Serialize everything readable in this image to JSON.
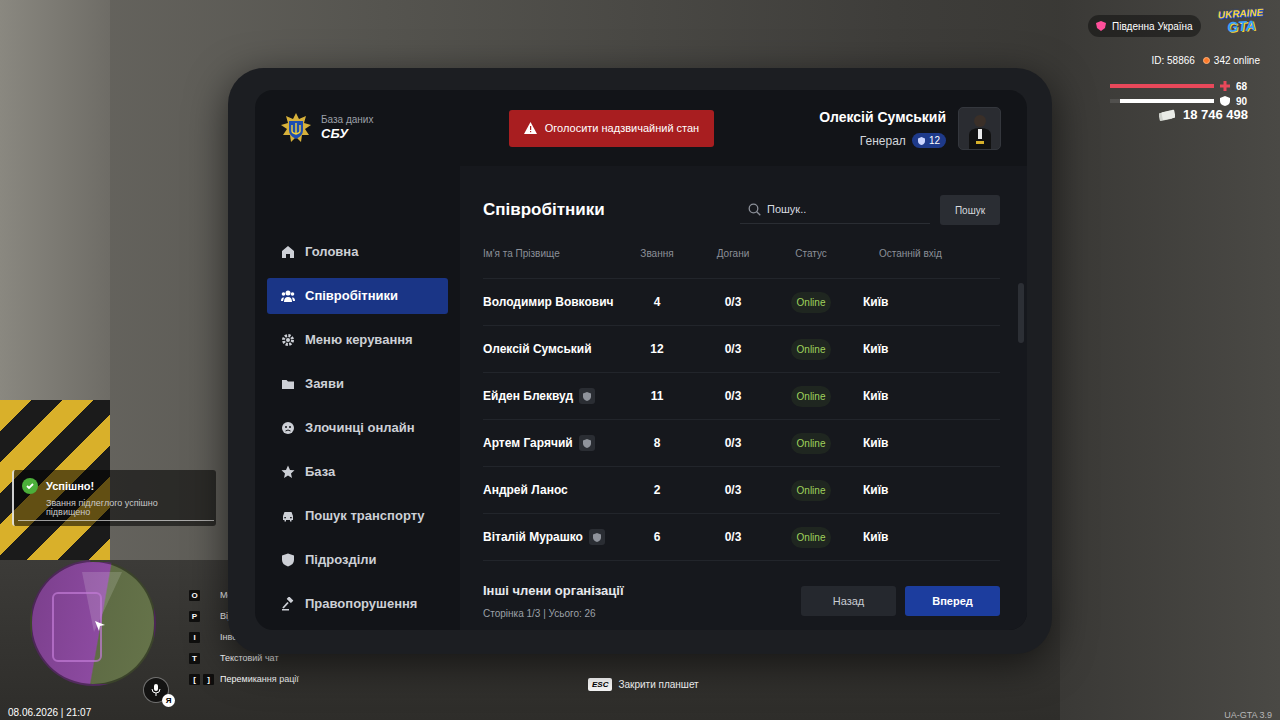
{
  "region": {
    "label": "Південна Україна"
  },
  "logo": {
    "line1": "UKRAINE",
    "line2": "GTA"
  },
  "server": {
    "id": "ID: 58866",
    "online": "342 online"
  },
  "vitals": [
    {
      "kind": "health",
      "value": "68",
      "level": 1,
      "color": "#e8485a"
    },
    {
      "kind": "armor",
      "value": "90",
      "level": 0.9,
      "color": "#ffffff"
    }
  ],
  "money": "18 746 498",
  "tablet": {
    "brand": {
      "caption": "База даних",
      "title": "СБУ"
    },
    "emergency_button": "Оголосити надзвичайний стан",
    "user": {
      "name": "Олексій Сумський",
      "rank": "Генерал",
      "level": "12"
    },
    "sidebar": {
      "items": [
        {
          "label": "Головна",
          "selected": false
        },
        {
          "label": "Співробітники",
          "selected": true
        },
        {
          "label": "Меню керування",
          "selected": false
        },
        {
          "label": "Заяви",
          "selected": false
        },
        {
          "label": "Злочинці онлайн",
          "selected": false
        },
        {
          "label": "База",
          "selected": false
        },
        {
          "label": "Пошук транспорту",
          "selected": false
        },
        {
          "label": "Підрозділи",
          "selected": false
        },
        {
          "label": "Правопорушення",
          "selected": false
        }
      ]
    },
    "page": {
      "title": "Співробітники",
      "search": {
        "placeholder": "Пошук..",
        "button": "Пошук"
      },
      "table": {
        "columns": [
          "Ім'я та Прізвище",
          "Звання",
          "Догани",
          "Статус",
          "Останній вхід"
        ],
        "rows": [
          {
            "name": "Володимир Вовкович",
            "badge": false,
            "rank": "4",
            "reprimands": "0/3",
            "status": "Online",
            "last_login": "Київ"
          },
          {
            "name": "Олексій Сумський",
            "badge": false,
            "rank": "12",
            "reprimands": "0/3",
            "status": "Online",
            "last_login": "Київ"
          },
          {
            "name": "Ейден Блеквуд",
            "badge": true,
            "rank": "11",
            "reprimands": "0/3",
            "status": "Online",
            "last_login": "Київ"
          },
          {
            "name": "Артем Гарячий",
            "badge": true,
            "rank": "8",
            "reprimands": "0/3",
            "status": "Online",
            "last_login": "Київ"
          },
          {
            "name": "Андрей Ланос",
            "badge": false,
            "rank": "2",
            "reprimands": "0/3",
            "status": "Online",
            "last_login": "Київ"
          },
          {
            "name": "Віталій Мурашко",
            "badge": true,
            "rank": "6",
            "reprimands": "0/3",
            "status": "Online",
            "last_login": "Київ"
          }
        ]
      },
      "footer": {
        "title": "Інші члени організації",
        "page_info": "Сторінка 1/3 | Усього: 26",
        "prev": "Назад",
        "next": "Вперед"
      }
    }
  },
  "notification": {
    "title": "Успішно!",
    "message": "Звання підлеглого успішно підвищено"
  },
  "keybinds": [
    {
      "keys": [
        "O"
      ],
      "label": "Мен"
    },
    {
      "keys": [
        "P"
      ],
      "label": "Відк"
    },
    {
      "keys": [
        "I"
      ],
      "label": "Інвент"
    },
    {
      "keys": [
        "T"
      ],
      "label": "Текстовий чат"
    },
    {
      "keys": [
        "[",
        "]"
      ],
      "label": "Перемикання рації"
    }
  ],
  "mic": {
    "badge": "Я"
  },
  "datetime": "08.06.2026 | 21:07",
  "close_hint": {
    "key": "ESC",
    "label": "Закрити планшет"
  },
  "version": "UA-GTA 3.9"
}
